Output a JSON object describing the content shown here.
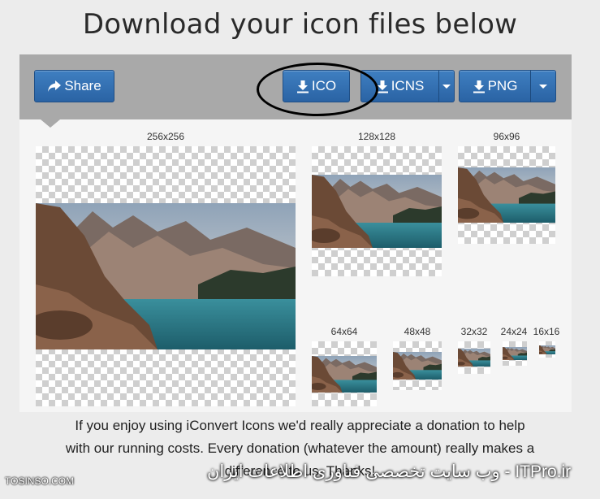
{
  "page": {
    "title": "Download your icon files below"
  },
  "toolbar": {
    "share_label": "Share",
    "ico_label": "ICO",
    "icns_label": "ICNS",
    "png_label": "PNG"
  },
  "previews": [
    {
      "label": "256x256"
    },
    {
      "label": "128x128"
    },
    {
      "label": "96x96"
    },
    {
      "label": "64x64"
    },
    {
      "label": "48x48"
    },
    {
      "label": "32x32"
    },
    {
      "label": "24x24"
    },
    {
      "label": "16x16"
    }
  ],
  "donation": {
    "line1": "If you enjoy using iConvert Icons we'd really appreciate a donation to help",
    "line2": "with our running costs. Every donation (whatever the amount) really makes a",
    "line3": "difference to us. Thanks!"
  },
  "watermark": {
    "left": "TOSINSO.COM",
    "right": "وب سایت تخصصی فناوری اطلاعات ایران - ITPro.ir"
  },
  "colors": {
    "button": "#2f6bb0",
    "toolbar": "#a9a9a9",
    "annotation": "#000000"
  }
}
